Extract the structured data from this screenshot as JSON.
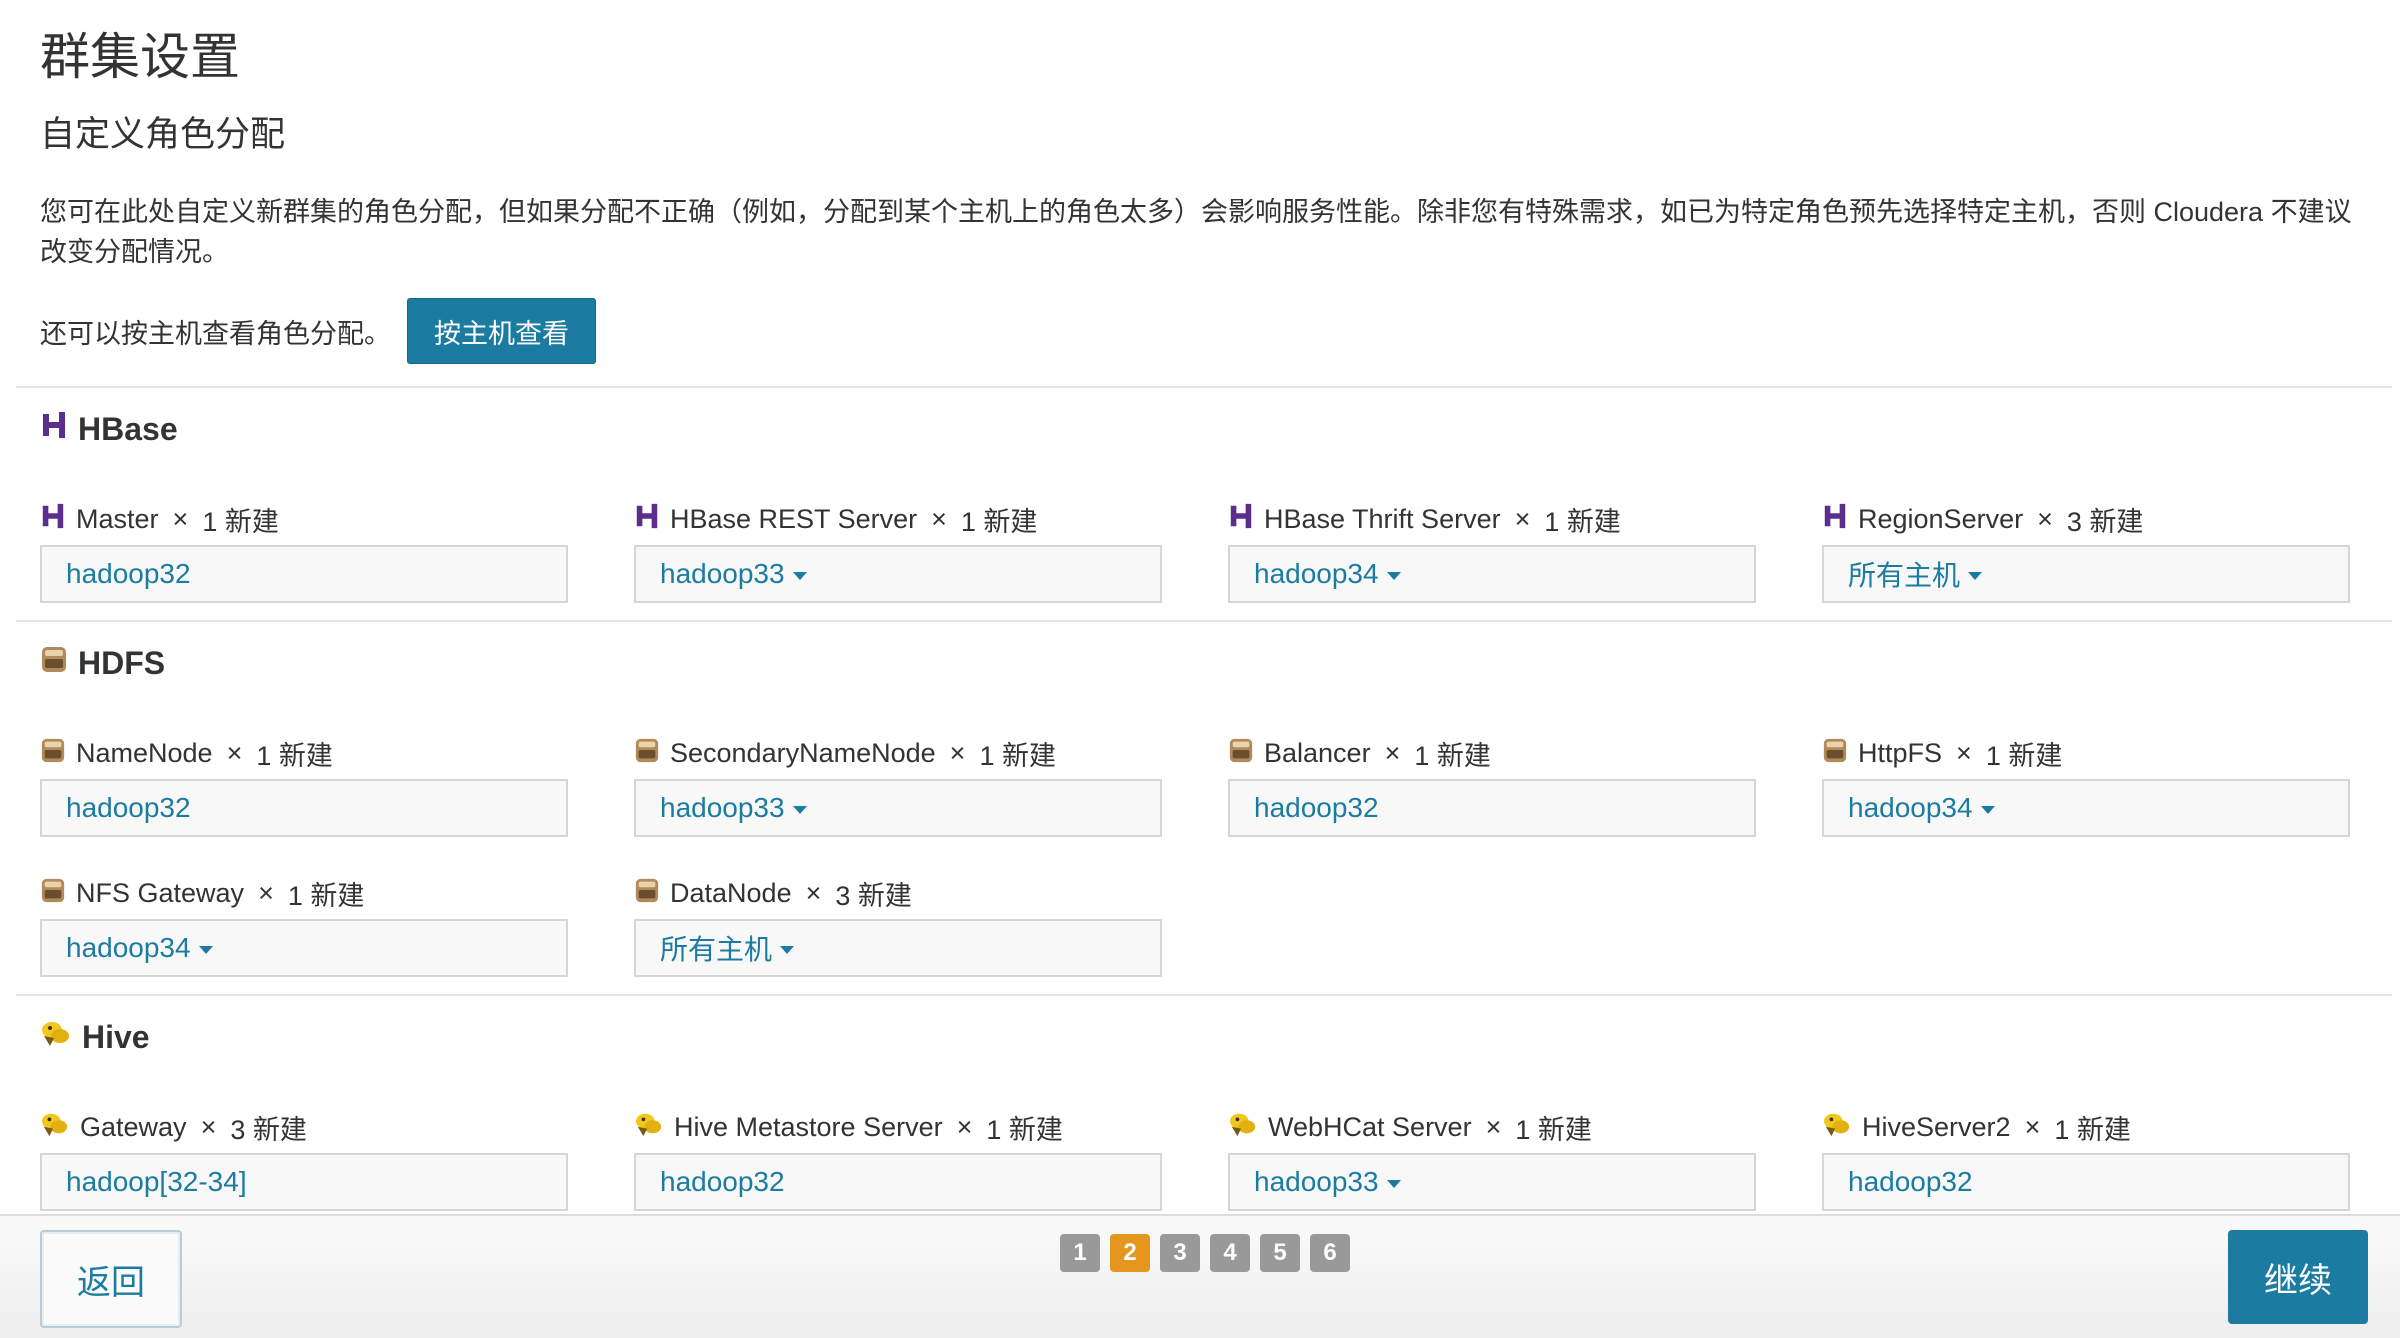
{
  "header": {
    "title": "群集设置",
    "subtitle": "自定义角色分配",
    "description": "您可在此处自定义新群集的角色分配，但如果分配不正确（例如，分配到某个主机上的角色太多）会影响服务性能。除非您有特殊需求，如已为特定角色预先选择特定主机，否则 Cloudera 不建议改变分配情况。",
    "by_host_text": "还可以按主机查看角色分配。",
    "by_host_button": "按主机查看"
  },
  "times": "×",
  "services": {
    "hbase": {
      "name": "HBase",
      "icon": "hbase-icon",
      "roles": [
        {
          "name": "Master",
          "count": "1 新建",
          "host": "hadoop32",
          "dropdown": false
        },
        {
          "name": "HBase REST Server",
          "count": "1 新建",
          "host": "hadoop33",
          "dropdown": true
        },
        {
          "name": "HBase Thrift Server",
          "count": "1 新建",
          "host": "hadoop34",
          "dropdown": true
        },
        {
          "name": "RegionServer",
          "count": "3 新建",
          "host": "所有主机",
          "dropdown": true
        }
      ]
    },
    "hdfs": {
      "name": "HDFS",
      "icon": "hdfs-icon",
      "roles": [
        {
          "name": "NameNode",
          "count": "1 新建",
          "host": "hadoop32",
          "dropdown": false
        },
        {
          "name": "SecondaryNameNode",
          "count": "1 新建",
          "host": "hadoop33",
          "dropdown": true
        },
        {
          "name": "Balancer",
          "count": "1 新建",
          "host": "hadoop32",
          "dropdown": false
        },
        {
          "name": "HttpFS",
          "count": "1 新建",
          "host": "hadoop34",
          "dropdown": true
        },
        {
          "name": "NFS Gateway",
          "count": "1 新建",
          "host": "hadoop34",
          "dropdown": true
        },
        {
          "name": "DataNode",
          "count": "3 新建",
          "host": "所有主机",
          "dropdown": true
        }
      ]
    },
    "hive": {
      "name": "Hive",
      "icon": "hive-icon",
      "roles": [
        {
          "name": "Gateway",
          "count": "3 新建",
          "host": "hadoop[32-34]",
          "dropdown": false
        },
        {
          "name": "Hive Metastore Server",
          "count": "1 新建",
          "host": "hadoop32",
          "dropdown": false
        },
        {
          "name": "WebHCat Server",
          "count": "1 新建",
          "host": "hadoop33",
          "dropdown": true
        },
        {
          "name": "HiveServer2",
          "count": "1 新建",
          "host": "hadoop32",
          "dropdown": false
        }
      ]
    }
  },
  "footer": {
    "back_label": "返回",
    "continue_label": "继续",
    "pages": [
      "1",
      "2",
      "3",
      "4",
      "5",
      "6"
    ],
    "active_page": "2"
  },
  "colors": {
    "accent": "#1b7ba1",
    "hbase_icon": "#5b2d8c",
    "active_page": "#e4961e",
    "inactive_page": "#999999"
  }
}
